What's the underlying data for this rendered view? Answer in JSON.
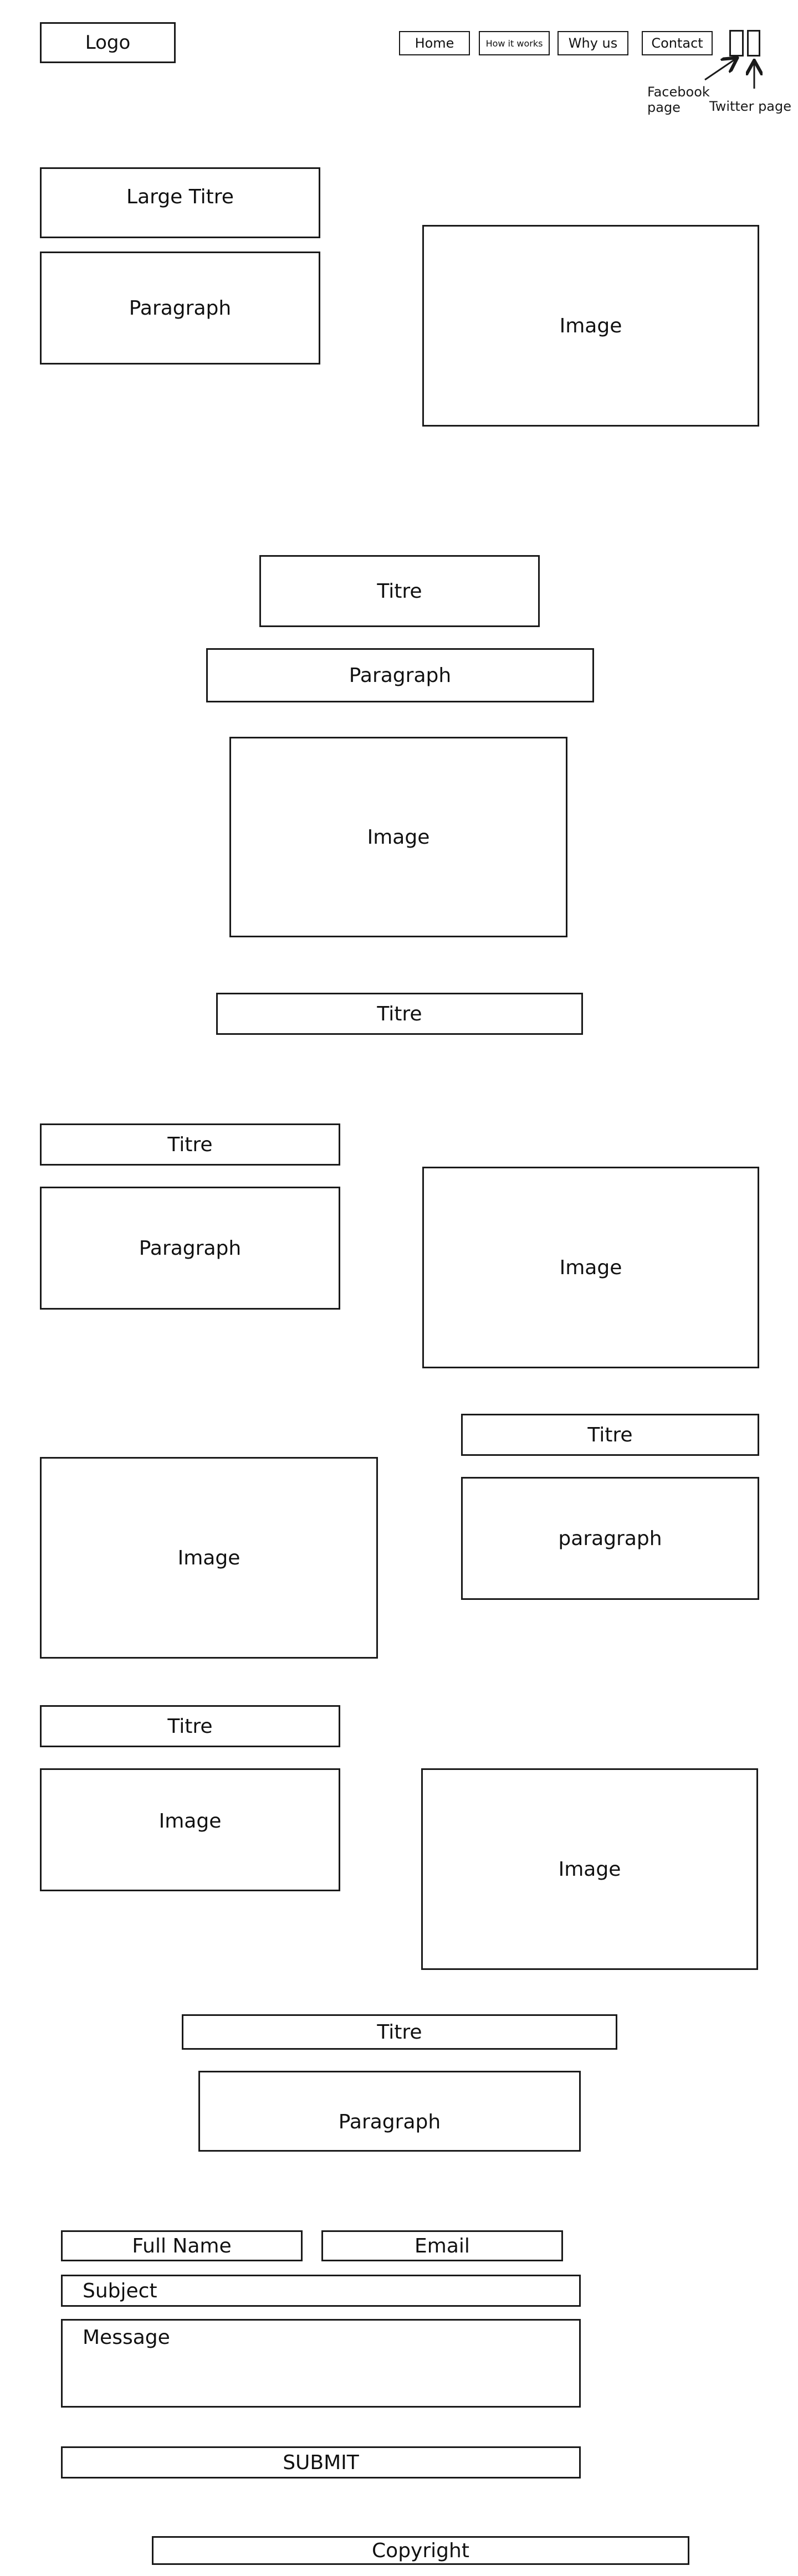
{
  "header": {
    "logo": "Logo",
    "nav": [
      "Home",
      "How it works",
      "Why us",
      "Contact"
    ],
    "social": {
      "facebook_label": "Facebook page",
      "twitter_label": "Twitter page"
    }
  },
  "hero": {
    "title": "Large Titre",
    "paragraph": "Paragraph",
    "image": "Image"
  },
  "section2": {
    "title": "Titre",
    "paragraph": "Paragraph",
    "image": "Image",
    "subtitle": "Titre"
  },
  "section3": {
    "title": "Titre",
    "paragraph": "Paragraph",
    "image": "Image"
  },
  "section4": {
    "image": "Image",
    "title": "Titre",
    "paragraph": "paragraph"
  },
  "section5": {
    "title": "Titre",
    "image_small": "Image",
    "image_large": "Image"
  },
  "section6": {
    "title": "Titre",
    "paragraph": "Paragraph"
  },
  "form": {
    "full_name": "Full Name",
    "email": "Email",
    "subject": "Subject",
    "message": "Message",
    "submit": "SUBMIT"
  },
  "footer": {
    "copyright": "Copyright"
  }
}
